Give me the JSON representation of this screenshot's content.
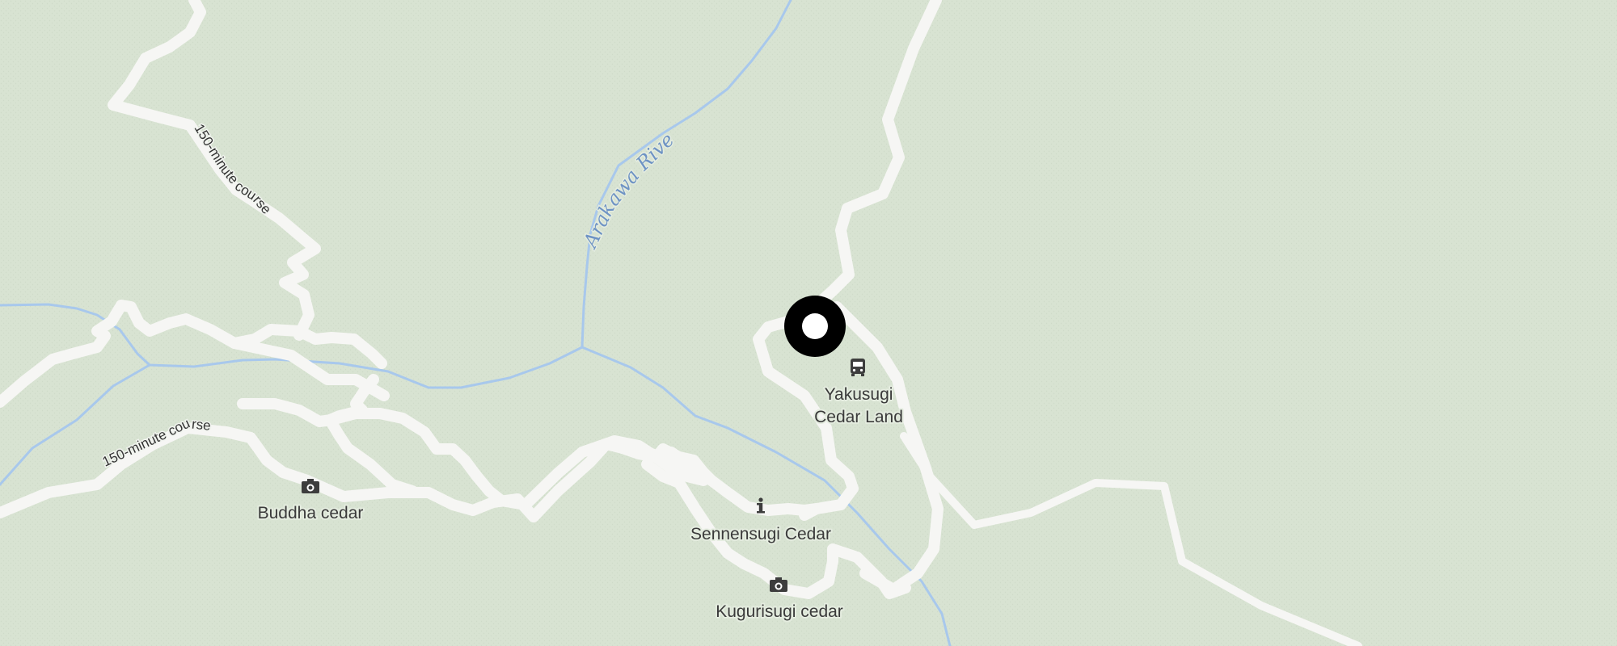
{
  "map": {
    "background_color": "#d8e3d2",
    "road_color": "#f6f6f4",
    "water_color": "#a8c8ec",
    "marker_color": "#000000"
  },
  "labels": {
    "river": "Arakawa River",
    "course_1": "150-minute course",
    "course_2": "150-minute course",
    "buddha_cedar": "Buddha cedar",
    "sennensugi": "Sennensugi Cedar",
    "kugurisugi": "Kugurisugi cedar",
    "yakusugi_line1": "Yakusugi",
    "yakusugi_line2": "Cedar Land"
  },
  "icons": {
    "buddha_cedar": "camera-icon",
    "kugurisugi": "camera-icon",
    "sennensugi": "info-icon",
    "yakusugi": "bus-icon",
    "marker": "location-marker-icon"
  }
}
